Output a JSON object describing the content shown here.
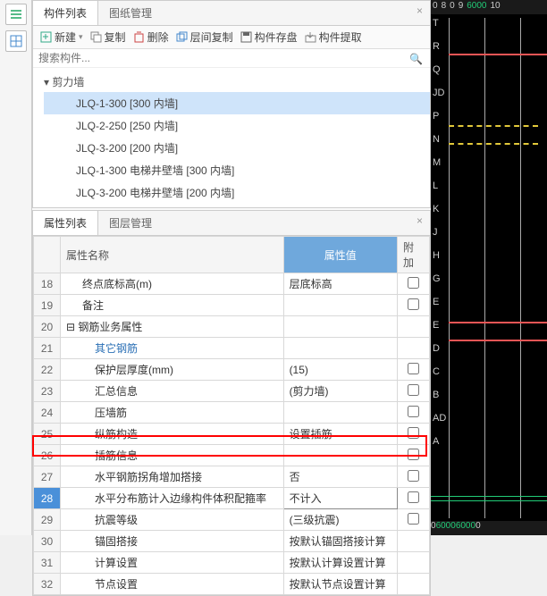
{
  "leftbar": {
    "icon1": "list-icon",
    "icon2": "grid-icon"
  },
  "component_panel": {
    "tabs": {
      "list": "构件列表",
      "drawing": "图纸管理"
    },
    "toolbar": {
      "new": "新建",
      "copy": "复制",
      "delete": "删除",
      "layercopy": "层间复制",
      "save": "构件存盘",
      "extract": "构件提取"
    },
    "search_placeholder": "搜索构件...",
    "tree": {
      "parent": "剪力墙",
      "items": [
        "JLQ-1-300 [300 内墙]",
        "JLQ-2-250 [250 内墙]",
        "JLQ-3-200 [200 内墙]",
        "JLQ-1-300 电梯井壁墙 [300 内墙]",
        "JLQ-3-200 电梯井壁墙 [200 内墙]"
      ]
    }
  },
  "prop_panel": {
    "tabs": {
      "prop": "属性列表",
      "layer": "图层管理"
    },
    "headers": {
      "name": "属性名称",
      "value": "属性值",
      "extra": "附加"
    },
    "rows": [
      {
        "n": "18",
        "name": "终点底标高(m)",
        "val": "层底标高",
        "chk": true,
        "ind": 1
      },
      {
        "n": "19",
        "name": "备注",
        "val": "",
        "chk": true,
        "ind": 1
      },
      {
        "n": "20",
        "name": "钢筋业务属性",
        "val": "",
        "chk": false,
        "group": true,
        "ind": 0,
        "exp": "⊟"
      },
      {
        "n": "21",
        "name": "其它钢筋",
        "val": "",
        "chk": false,
        "ind": 2,
        "link": true
      },
      {
        "n": "22",
        "name": "保护层厚度(mm)",
        "val": "(15)",
        "chk": true,
        "ind": 2
      },
      {
        "n": "23",
        "name": "汇总信息",
        "val": "(剪力墙)",
        "chk": true,
        "ind": 2
      },
      {
        "n": "24",
        "name": "压墙筋",
        "val": "",
        "chk": true,
        "ind": 2
      },
      {
        "n": "25",
        "name": "纵筋构造",
        "val": "设置插筋",
        "chk": true,
        "ind": 2
      },
      {
        "n": "26",
        "name": "插筋信息",
        "val": "",
        "chk": true,
        "ind": 2
      },
      {
        "n": "27",
        "name": "水平钢筋拐角增加搭接",
        "val": "否",
        "chk": true,
        "ind": 2
      },
      {
        "n": "28",
        "name": "水平分布筋计入边缘构件体积配箍率",
        "val": "不计入",
        "chk": true,
        "ind": 2,
        "sel": true
      },
      {
        "n": "29",
        "name": "抗震等级",
        "val": "(三级抗震)",
        "chk": true,
        "ind": 2
      },
      {
        "n": "30",
        "name": "锚固搭接",
        "val": "按默认锚固搭接计算",
        "chk": false,
        "ind": 2
      },
      {
        "n": "31",
        "name": "计算设置",
        "val": "按默认计算设置计算",
        "chk": false,
        "ind": 2
      },
      {
        "n": "32",
        "name": "节点设置",
        "val": "按默认节点设置计算",
        "chk": false,
        "ind": 2
      }
    ]
  },
  "canvas": {
    "ruler_top": [
      "0",
      "8",
      "0",
      "9",
      "6000",
      "10"
    ],
    "ruler_bottom": [
      "0",
      "6000",
      "6000",
      "0"
    ],
    "vlabels": [
      "T",
      "R",
      "Q",
      "JD",
      "P",
      "N",
      "M",
      "L",
      "K",
      "J",
      "H",
      "G",
      "E",
      "E",
      "D",
      "C",
      "B",
      "AD",
      "A"
    ]
  }
}
